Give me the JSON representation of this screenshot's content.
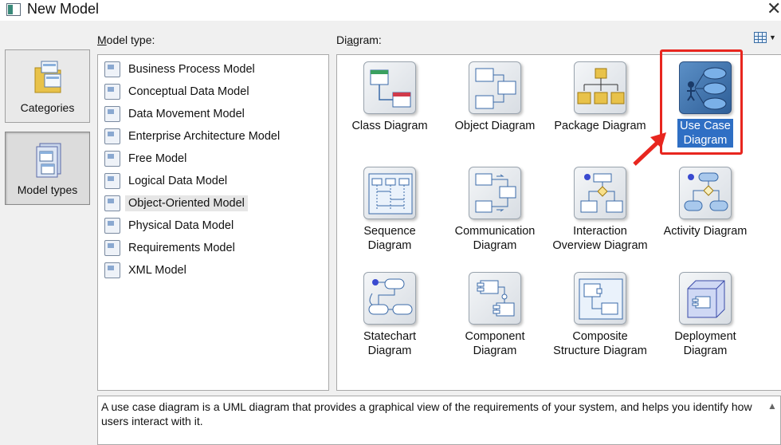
{
  "window": {
    "title": "New Model",
    "close_glyph": "✕"
  },
  "nav": {
    "items": [
      {
        "label": "Categories",
        "icon": "categories-icon"
      },
      {
        "label": "Model types",
        "icon": "model-types-icon",
        "active": true
      }
    ]
  },
  "model_type": {
    "label_prefix": "M",
    "label_rest": "odel type:",
    "items": [
      {
        "label": "Business Process Model"
      },
      {
        "label": "Conceptual Data Model"
      },
      {
        "label": "Data Movement Model"
      },
      {
        "label": "Enterprise Architecture Model"
      },
      {
        "label": "Free Model"
      },
      {
        "label": "Logical Data Model"
      },
      {
        "label": "Object-Oriented Model",
        "selected": true
      },
      {
        "label": "Physical Data Model"
      },
      {
        "label": "Requirements Model"
      },
      {
        "label": "XML Model"
      }
    ]
  },
  "diagram": {
    "label_prefix": "Di",
    "label_under": "a",
    "label_rest": "gram:",
    "items": [
      {
        "label": "Class Diagram",
        "icon": "class-diagram-icon"
      },
      {
        "label": "Object Diagram",
        "icon": "object-diagram-icon"
      },
      {
        "label": "Package Diagram",
        "icon": "package-diagram-icon"
      },
      {
        "label": "Use Case\nDiagram",
        "icon": "use-case-diagram-icon",
        "selected": true
      },
      {
        "label": "Sequence\nDiagram",
        "icon": "sequence-diagram-icon"
      },
      {
        "label": "Communication\nDiagram",
        "icon": "communication-diagram-icon"
      },
      {
        "label": "Interaction\nOverview Diagram",
        "icon": "interaction-overview-icon"
      },
      {
        "label": "Activity Diagram",
        "icon": "activity-diagram-icon"
      },
      {
        "label": "Statechart\nDiagram",
        "icon": "statechart-diagram-icon"
      },
      {
        "label": "Component\nDiagram",
        "icon": "component-diagram-icon"
      },
      {
        "label": "Composite\nStructure Diagram",
        "icon": "composite-structure-icon"
      },
      {
        "label": "Deployment\nDiagram",
        "icon": "deployment-diagram-icon"
      }
    ]
  },
  "description": "A use case diagram is a UML diagram that provides a graphical view of the requirements of your system, and helps you identify how users interact with it.",
  "colors": {
    "selection": "#2f6fc4",
    "highlight": "#e8261f"
  }
}
